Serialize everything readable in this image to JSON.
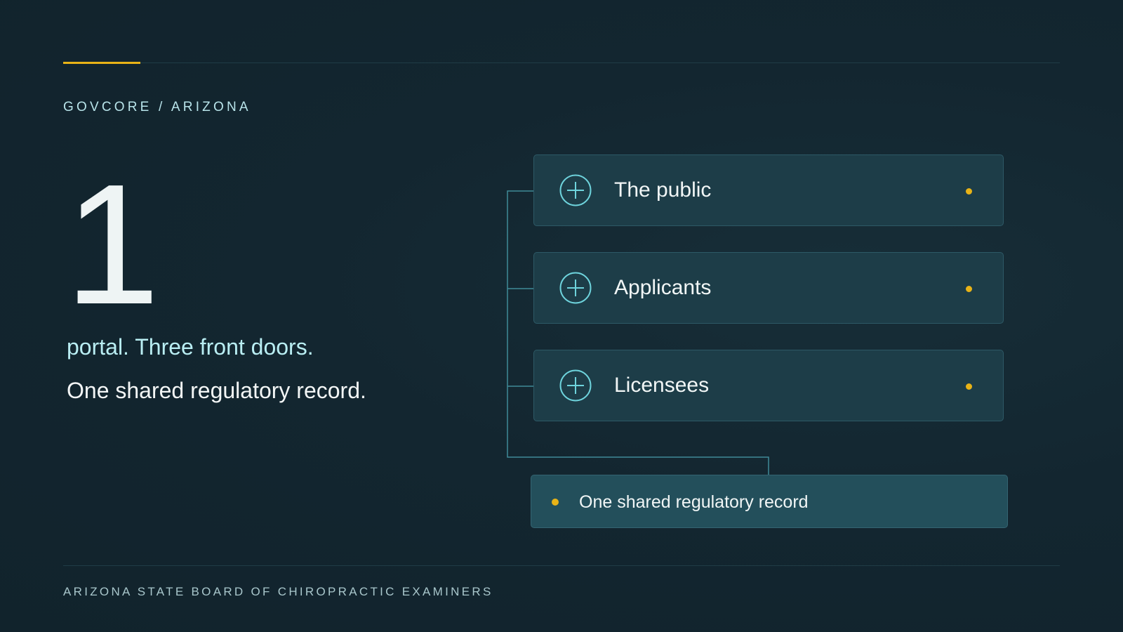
{
  "header": {
    "eyebrow": "GOVCORE / ARIZONA"
  },
  "hero": {
    "number": "1",
    "line_1": "portal. Three front doors.",
    "line_2": "One shared regulatory record."
  },
  "diagram": {
    "doors": [
      {
        "label": "The public",
        "icon": "plus-circle-icon"
      },
      {
        "label": "Applicants",
        "icon": "plus-circle-icon"
      },
      {
        "label": "Licensees",
        "icon": "plus-circle-icon"
      }
    ],
    "record": {
      "label": "One shared regulatory record"
    }
  },
  "footer": {
    "text": "ARIZONA STATE BOARD OF CHIROPRACTIC EXAMINERS"
  },
  "colors": {
    "background": "#132630",
    "accent": "#e8b317",
    "card": "#1d3d48",
    "record_card": "#234f5b",
    "highlight_text": "#b9eef3",
    "connector": "#3f8a98"
  }
}
